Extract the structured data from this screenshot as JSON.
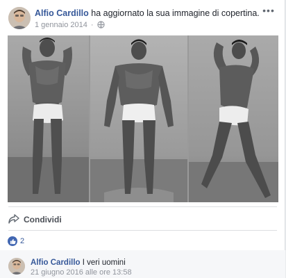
{
  "post": {
    "author": "Alfio Cardillo",
    "action": "ha aggiornato la sua immagine di copertina.",
    "date": "1 gennaio 2014",
    "separator": "·",
    "privacy_icon": "globe-icon",
    "more_icon": "more-options-icon",
    "more_label": "•••"
  },
  "photo": {
    "panels": [
      "left-pose",
      "center-pose",
      "right-pose"
    ]
  },
  "actions": {
    "share_label": "Condividi",
    "share_icon": "share-arrow-icon"
  },
  "reactions": {
    "like_icon": "like-thumb-icon",
    "count": "2"
  },
  "comment": {
    "author": "Alfio Cardillo",
    "text": "I veri uomini",
    "timestamp": "21 giugno 2016 alle ore 13:58"
  },
  "colors": {
    "link_blue": "#365899",
    "like_blue": "#4267b2",
    "meta_gray": "#90949c"
  }
}
